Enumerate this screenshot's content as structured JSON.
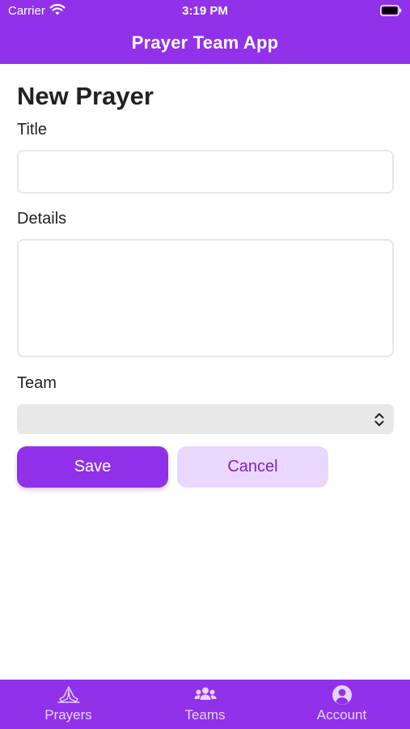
{
  "status_bar": {
    "carrier": "Carrier",
    "time": "3:19 PM"
  },
  "header": {
    "title": "Prayer Team App"
  },
  "form": {
    "heading": "New Prayer",
    "title_label": "Title",
    "title_value": "",
    "details_label": "Details",
    "details_value": "",
    "team_label": "Team",
    "team_selected": "",
    "save_label": "Save",
    "cancel_label": "Cancel"
  },
  "tabs": [
    {
      "label": "Prayers",
      "icon": "praying-hands-icon"
    },
    {
      "label": "Teams",
      "icon": "users-icon"
    },
    {
      "label": "Account",
      "icon": "user-circle-icon"
    }
  ],
  "colors": {
    "brand": "#9131ea",
    "cancel_bg": "#ead7fc",
    "select_bg": "#e8e8e8"
  }
}
